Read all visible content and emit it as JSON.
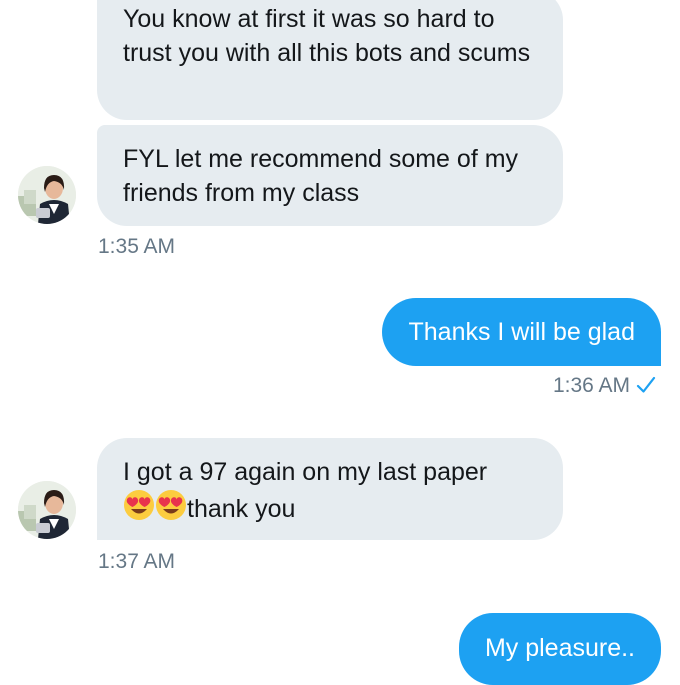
{
  "conversation": {
    "messages": [
      {
        "direction": "incoming",
        "text": "You know at first it was so hard to trust you with all this bots and scums"
      },
      {
        "direction": "incoming",
        "text": "FYL let me recommend some of my friends from my class",
        "timestamp": "1:35 AM"
      },
      {
        "direction": "outgoing",
        "text": "Thanks I will be glad",
        "timestamp": "1:36 AM",
        "status_icon": "check-icon"
      },
      {
        "direction": "incoming",
        "text": "I got a 97 again on my last paper",
        "emoji_icon": "heart-eyes-emoji-icon",
        "emoji_count": 2,
        "text_after_emoji": "thank you",
        "timestamp": "1:37 AM"
      },
      {
        "direction": "outgoing",
        "text": "My pleasure.."
      }
    ]
  },
  "colors": {
    "incoming_bubble": "#e6ecf0",
    "outgoing_bubble": "#1da1f2",
    "timestamp": "#657786",
    "check": "#1da1f2"
  }
}
